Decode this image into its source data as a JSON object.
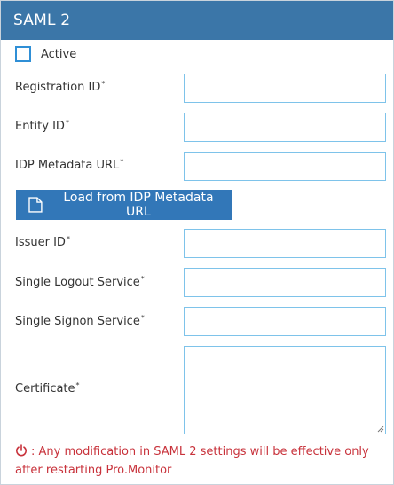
{
  "header": {
    "title": "SAML 2"
  },
  "active": {
    "label": "Active",
    "checked": false
  },
  "fields": {
    "registration_id": {
      "label": "Registration ID",
      "required_mark": "*",
      "value": ""
    },
    "entity_id": {
      "label": "Entity ID",
      "required_mark": "*",
      "value": ""
    },
    "idp_metadata_url": {
      "label": "IDP Metadata URL",
      "required_mark": "*",
      "value": ""
    },
    "issuer_id": {
      "label": "Issuer ID",
      "required_mark": "*",
      "value": ""
    },
    "single_logout_service": {
      "label": "Single Logout Service",
      "required_mark": "*",
      "value": ""
    },
    "single_signon_service": {
      "label": "Single Signon Service",
      "required_mark": "*",
      "value": ""
    },
    "certificate": {
      "label": "Certificate",
      "required_mark": "*",
      "value": ""
    }
  },
  "load_button": {
    "label": "Load from IDP Metadata URL",
    "icon": "document-icon"
  },
  "notice": {
    "icon": "power-icon",
    "text": ": Any modification in SAML 2 settings will be effective only after restarting Pro.Monitor"
  },
  "colors": {
    "header_bg": "#3b76a8",
    "button_bg": "#3277b8",
    "input_border": "#7ec3ea",
    "notice": "#c8323b"
  }
}
